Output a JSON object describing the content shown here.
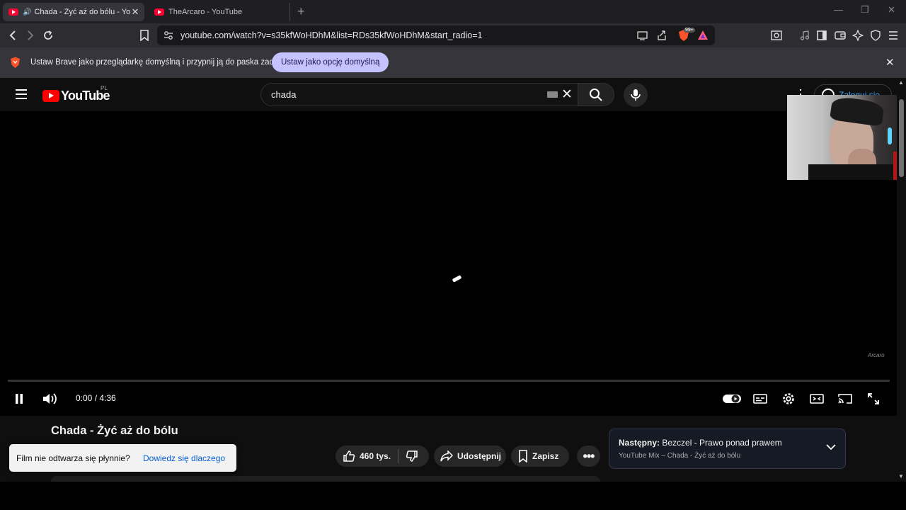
{
  "browser": {
    "tabs": [
      {
        "title": "Chada - Żyć aż do bólu - YouTube",
        "active": true,
        "audio": true
      },
      {
        "title": "TheArcaro - YouTube",
        "active": false
      }
    ],
    "new_tab_symbol": "+",
    "window_controls": {
      "minimize": "—",
      "restore": "❐",
      "close": "✕"
    },
    "url": "youtube.com/watch?v=s35kfWoHDhM&list=RDs35kfWoHDhM&start_radio=1",
    "shields_badge": "99+"
  },
  "infobar": {
    "message": "Ustaw Brave jako przeglądarkę domyślną i przypnij ją do paska zadań",
    "button": "Ustaw jako opcję domyślną",
    "close_symbol": "✕"
  },
  "youtube": {
    "logo": "YouTube",
    "country": "PL",
    "search": {
      "value": "chada"
    },
    "signin": "Zaloguj się",
    "player": {
      "time": "0:00 / 4:36",
      "played_fraction": 0.0,
      "watermark": "Arcaro"
    },
    "video": {
      "title": "Chada - Żyć aż do bólu",
      "likes": "460 tys.",
      "share": "Udostępnij",
      "save": "Zapisz"
    },
    "next": {
      "label": "Następny:",
      "title": "Bezczel - Prawo ponad prawem",
      "subtitle": "YouTube Mix – Chada - Żyć aż do bólu"
    },
    "toast": {
      "message": "Film nie odtwarza się płynnie?",
      "link": "Dowiedz się dlaczego"
    }
  },
  "colors": {
    "youtube_red": "#ff0000",
    "brave_accent": "#c4c2ff",
    "link_blue": "#065fd4",
    "signin_blue": "#3ea6ff"
  }
}
